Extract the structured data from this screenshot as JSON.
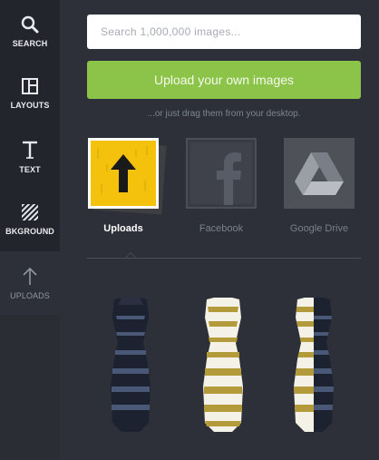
{
  "sidebar": {
    "items": [
      {
        "label": "SEARCH",
        "icon": "magnifier-icon"
      },
      {
        "label": "LAYOUTS",
        "icon": "layout-icon"
      },
      {
        "label": "TEXT",
        "icon": "text-T-icon"
      },
      {
        "label": "BKGROUND",
        "icon": "hatch-icon"
      },
      {
        "label": "UPLOADS",
        "icon": "upload-arrow-icon"
      }
    ],
    "active": "UPLOADS"
  },
  "search": {
    "placeholder": "Search 1,000,000 images..."
  },
  "upload": {
    "button_label": "Upload your own images",
    "hint": "...or just drag them from your desktop."
  },
  "sources": [
    {
      "label": "Uploads",
      "icon": "upload-arrow-icon",
      "selected": true
    },
    {
      "label": "Facebook",
      "icon": "facebook-icon",
      "selected": false
    },
    {
      "label": "Google Drive",
      "icon": "google-drive-icon",
      "selected": false
    }
  ],
  "images": [
    "blue-black-dress",
    "white-gold-dress",
    "split-dress"
  ],
  "colors": {
    "accent": "#8cc44a",
    "sidebar": "#22252b",
    "panel": "#2d3038",
    "uploads_tile": "#f4c20d"
  }
}
